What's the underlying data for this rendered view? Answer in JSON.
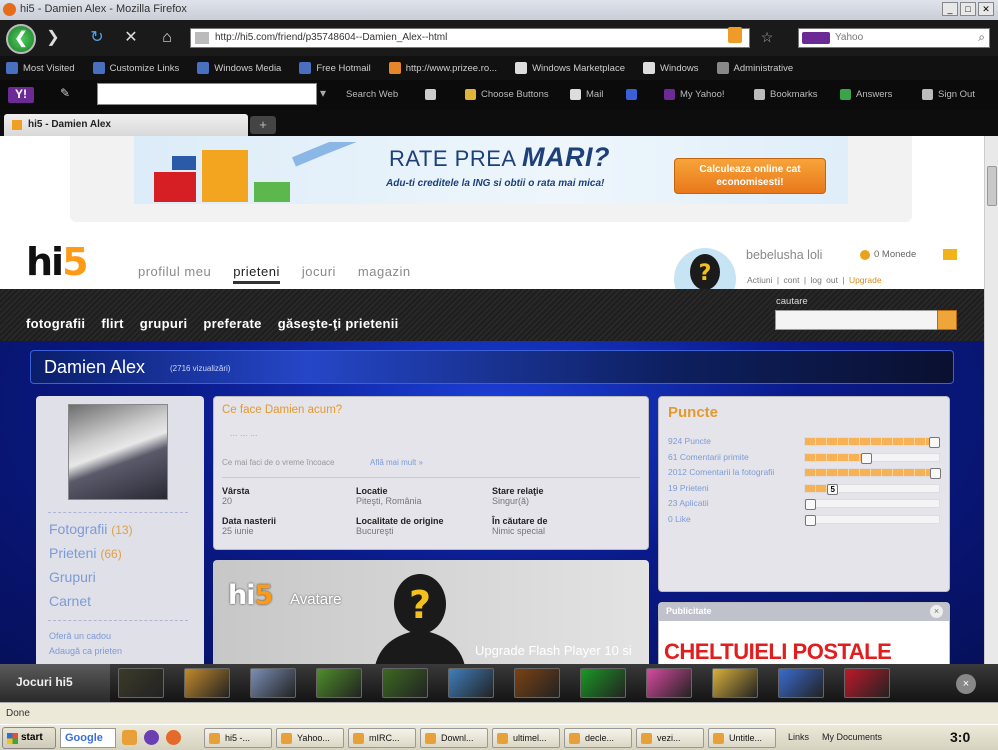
{
  "window": {
    "title": "hi5 - Damien Alex - Mozilla Firefox"
  },
  "nav": {
    "url": "http://hi5.com/friend/p35748604--Damien_Alex--html",
    "search_placeholder": "Yahoo"
  },
  "bookmarks": [
    "Most Visited",
    "Customize Links",
    "Windows Media",
    "Free Hotmail",
    "http://www.prizee.ro...",
    "Windows Marketplace",
    "Windows",
    "Administrative"
  ],
  "yahoo_toolbar": {
    "search_btn": "Search Web",
    "choose_buttons": "Choose Buttons",
    "mail": "Mail",
    "my_yahoo": "My Yahoo!",
    "bookmarks": "Bookmarks",
    "answers": "Answers",
    "sign_out": "Sign Out"
  },
  "tab": {
    "label": "hi5 - Damien Alex"
  },
  "ad": {
    "title_a": "RATE PREA ",
    "title_b": "MARI?",
    "subtitle": "Adu-ti creditele la ING si obtii o rata mai mica!",
    "button": "Calculeaza online cat economisesti!"
  },
  "hi5": {
    "logo_a": "hi",
    "logo_b": "5",
    "top_nav": [
      "profilul meu",
      "prieteni",
      "jocuri",
      "magazin"
    ],
    "active_nav": 1,
    "user": {
      "name": "bebelusha loli",
      "coins": "0 Monede",
      "links": [
        "Actiuni",
        "cont",
        "log out"
      ],
      "upgrade": "Upgrade"
    },
    "sub_nav": [
      "fotografii",
      "flirt",
      "grupuri",
      "preferate",
      "găseşte-ţi prietenii"
    ],
    "search_label": "cautare"
  },
  "profile": {
    "name": "Damien Alex",
    "visits": "(2716 vizualizări)",
    "left_links": [
      {
        "label": "Fotografii",
        "count": "(13)"
      },
      {
        "label": "Prieteni",
        "count": "(66)"
      },
      {
        "label": "Grupuri",
        "count": ""
      },
      {
        "label": "Carnet",
        "count": ""
      }
    ],
    "small_links": [
      "Oferă un cadou",
      "Adaugă ca prieten"
    ],
    "question": "Ce face Damien acum?",
    "status_dots": "... ... ...",
    "small_note": "Ce mai faci de o vreme încoace",
    "more_link": "Află mai mult »",
    "fields": [
      {
        "label": "Vârsta",
        "value": "20"
      },
      {
        "label": "Locatie",
        "value": "Piteşti, România"
      },
      {
        "label": "Stare relaţie",
        "value": "Singur(ă)"
      },
      {
        "label": "Data nasterii",
        "value": "25 iunie"
      },
      {
        "label": "Localitate de origine",
        "value": "Bucureşti"
      },
      {
        "label": "În căutare de",
        "value": "Nimic special"
      }
    ],
    "avatar_logo_a": "hi",
    "avatar_logo_b": "5",
    "avatar_title": "Avatare",
    "flash_text": "Upgrade Flash Player 10 si"
  },
  "points": {
    "title": "Puncte",
    "rows": [
      {
        "label": "924 Puncte",
        "fill": 0.95,
        "marker": ""
      },
      {
        "label": "61 Comentarii primite",
        "fill": 0.45,
        "marker": ""
      },
      {
        "label": "2012 Comentarii la fotografii",
        "fill": 1.0,
        "marker": ""
      },
      {
        "label": "19 Prieteni",
        "fill": 0.2,
        "marker": "5"
      },
      {
        "label": "23 Aplicatii",
        "fill": 0.0,
        "marker": ""
      },
      {
        "label": "0 Like",
        "fill": 0.0,
        "marker": ""
      }
    ]
  },
  "publicity": {
    "title": "Publicitate",
    "headline": "CHELTUIELI POSTALE"
  },
  "games_bar": {
    "label": "Jocuri hi5",
    "colors": [
      "#3b3b2a",
      "#c48a2a",
      "#7b8fb6",
      "#4f8e2a",
      "#3c6a21",
      "#3f7fbd",
      "#7b4213",
      "#1a9a24",
      "#d84aa0",
      "#d9b13a",
      "#3a6bd1",
      "#c0182a"
    ]
  },
  "statusbar": {
    "text": "Done"
  },
  "taskbar": {
    "start": "start",
    "google": "Google",
    "tasks": [
      "hi5 -...",
      "Yahoo...",
      "mIRC...",
      "Downl...",
      "ultimel...",
      "decle...",
      "vezi...",
      "Untitle..."
    ],
    "links": "Links",
    "my_documents": "My Documents",
    "clock": "3:0"
  }
}
